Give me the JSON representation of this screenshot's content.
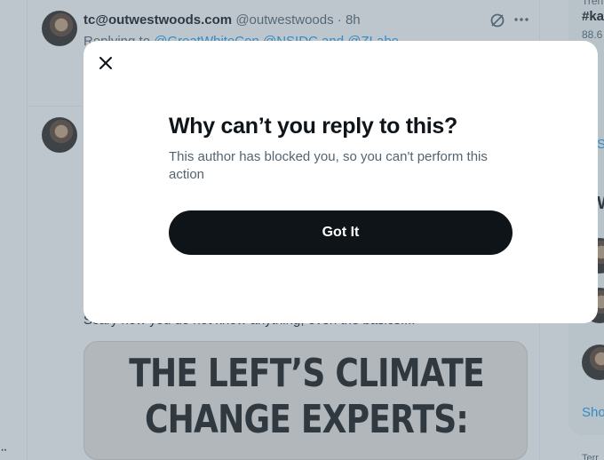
{
  "colors": {
    "text_primary": "#0f1419",
    "text_secondary": "#536471",
    "link": "#1d9bf0",
    "button_bg": "#0f1419",
    "button_text": "#ffffff",
    "overlay": "rgba(91,112,131,0.4)"
  },
  "feed": {
    "tweet1": {
      "author_name": "tc@outwestwoods.com",
      "handle": "@outwestwoods",
      "separator": "·",
      "time": "8h",
      "replying_to_label": "Replying to",
      "replying_to_mentions": "@GreatWhiteCon @NSIDC and @ZLabe",
      "icons": [
        "grok-icon",
        "more-icon"
      ]
    },
    "tweet2": {
      "text": "Scary how you do not know anything, even the basics....",
      "image_text_line1": "THE LEFT’S CLIMATE",
      "image_text_line2": "CHANGE EXPERTS:"
    }
  },
  "sidebar": {
    "trend_meta": "Tren",
    "trend_tag": "#ka",
    "trend_count": "88.6",
    "show_more_1": "Sho",
    "who_to_follow_heading": "W",
    "show_more_2": "Sho",
    "footer": "Terr"
  },
  "left_nav": {
    "more_glyph": "··"
  },
  "dialog": {
    "title": "Why can’t you reply to this?",
    "body": "This author has blocked you, so you can't perform this action",
    "button_label": "Got It",
    "close_icon": "close-icon"
  }
}
